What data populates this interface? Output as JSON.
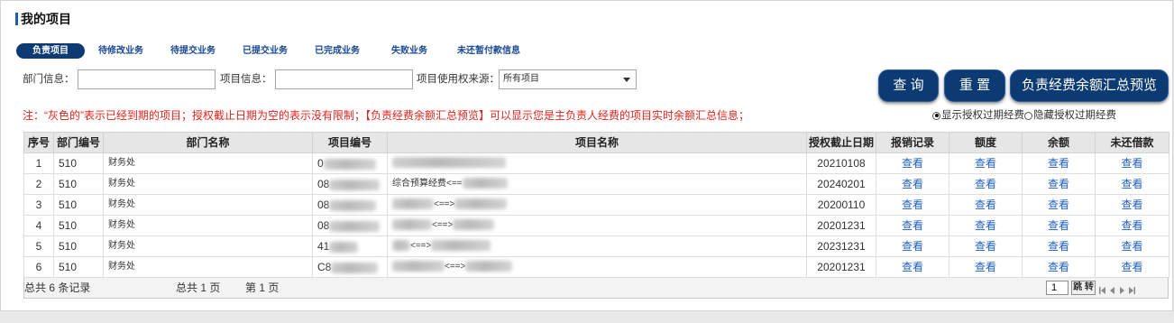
{
  "colors": {
    "navy": "#0c3a72",
    "tab_text": "#1b4a93",
    "link": "#2160c4",
    "note": "#e3241b",
    "title_bar": "#1f5fa8"
  },
  "page": {
    "title": "我的项目"
  },
  "tabs": [
    {
      "label": "负责项目",
      "active": true
    },
    {
      "label": "待修改业务",
      "active": false
    },
    {
      "label": "待提交业务",
      "active": false
    },
    {
      "label": "已提交业务",
      "active": false
    },
    {
      "label": "已完成业务",
      "active": false
    },
    {
      "label": "失败业务",
      "active": false
    },
    {
      "label": "未还暂付款信息",
      "active": false
    }
  ],
  "search": {
    "dept_label": "部门信息：",
    "dept_value": "",
    "project_label": "项目信息：",
    "project_value": "",
    "source_label": "项目使用权来源：",
    "source_selected": "所有项目"
  },
  "buttons": {
    "query": "查 询",
    "reset": "重 置",
    "preview": "负责经费余额汇总预览"
  },
  "note": "注：“灰色的”表示已经到期的项目；授权截止日期为空的表示没有限制；【负责经费余额汇总预览】可以显示您是主负责人经费的项目实时余额汇总信息；",
  "expired_filter": [
    {
      "label": "显示授权过期经费",
      "checked": true
    },
    {
      "label": "隐藏授权过期经费",
      "checked": false
    }
  ],
  "table": {
    "columns": [
      "序号",
      "部门编号",
      "部门名称",
      "项目编号",
      "项目名称",
      "授权截止日期",
      "报销记录",
      "额度",
      "余额",
      "未还借款"
    ],
    "view_label": "查看",
    "rows": [
      {
        "no": "1",
        "dept_code": "510",
        "dept_name": "财务处",
        "project_no": "0",
        "deadline": "20210108"
      },
      {
        "no": "2",
        "dept_code": "510",
        "dept_name": "财务处",
        "project_no": "08",
        "project_name": "综合预算经费<==",
        "deadline": "20240201"
      },
      {
        "no": "3",
        "dept_code": "510",
        "dept_name": "财务处",
        "project_no": "08",
        "project_name": "<==>",
        "deadline": "20200110"
      },
      {
        "no": "4",
        "dept_code": "510",
        "dept_name": "财务处",
        "project_no": "08",
        "project_name": "<==>",
        "deadline": "20201231"
      },
      {
        "no": "5",
        "dept_code": "510",
        "dept_name": "财务处",
        "project_no": "41",
        "project_name": "<==>",
        "deadline": "20231231"
      },
      {
        "no": "6",
        "dept_code": "510",
        "dept_name": "财务处",
        "project_no": "C8",
        "project_name": "<==>",
        "deadline": "20201231"
      }
    ]
  },
  "footer": {
    "total_records": "总共 6 条记录",
    "total_pages": "总共 1 页",
    "current_page": "第 1 页",
    "jump_value": "1",
    "jump_label": "跳 转"
  }
}
